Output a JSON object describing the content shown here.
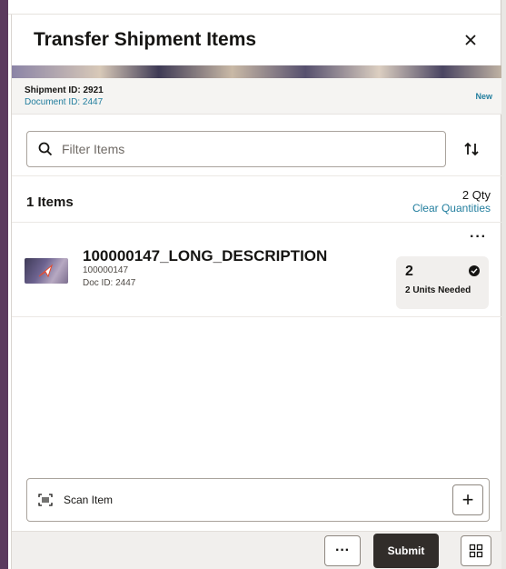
{
  "window": {
    "title": "Transfer Shipment Items",
    "close_icon": "close-icon"
  },
  "shipment": {
    "shipment_id": "Shipment ID: 2921",
    "document_id": "Document ID: 2447",
    "status": "New"
  },
  "filter": {
    "placeholder": "Filter Items",
    "value": "",
    "icon": "search-icon",
    "sort_icon": "sort-icon"
  },
  "summary": {
    "items_count": "1 Items",
    "total_qty": "2 Qty",
    "clear_label": "Clear Quantities"
  },
  "items": [
    {
      "title": "100000147_LONG_DESCRIPTION",
      "sku": "100000147",
      "doc_id": "Doc ID: 2447",
      "qty": "2",
      "needed": "2 Units Needed",
      "more_label": "···"
    }
  ],
  "scan": {
    "label": "Scan Item",
    "icon": "barcode-scan-icon",
    "add_label": "+"
  },
  "footer": {
    "more_label": "···",
    "submit_label": "Submit",
    "grid_icon": "grid-icon"
  },
  "colors": {
    "accent_link": "#227e9e",
    "primary_button": "#312d2a",
    "left_border": "#5b3a5e"
  }
}
